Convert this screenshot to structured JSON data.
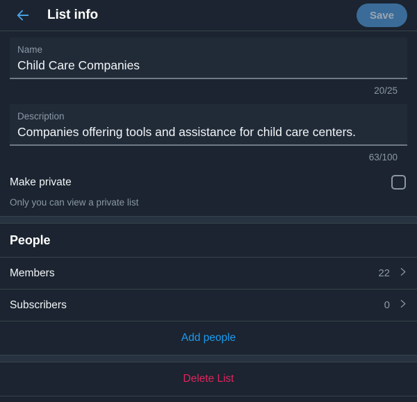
{
  "header": {
    "back_icon": "arrow-left-icon",
    "title": "List info",
    "save_label": "Save"
  },
  "form": {
    "name": {
      "label": "Name",
      "value": "Child Care Companies",
      "placeholder": "Name",
      "counter": "20/25"
    },
    "description": {
      "label": "Description",
      "value": "Companies offering tools and assistance for child care centers.",
      "placeholder": "Description",
      "counter": "63/100"
    },
    "private": {
      "label": "Make private",
      "hint": "Only you can view a private list",
      "checked": false
    }
  },
  "people": {
    "title": "People",
    "rows": [
      {
        "label": "Members",
        "count": "22",
        "chevron": "chevron-right-icon"
      },
      {
        "label": "Subscribers",
        "count": "0",
        "chevron": "chevron-right-icon"
      }
    ],
    "add_people_label": "Add people"
  },
  "danger": {
    "delete_label": "Delete List"
  },
  "colors": {
    "page_bg": "#1b2430",
    "field_bg": "#212b38",
    "band": "#273340",
    "divider": "#38444d",
    "accent": "#1d9bf0",
    "save_bg": "#3b6c99",
    "save_text": "#9aa6b2",
    "muted_text": "#8b98a5",
    "primary_text": "#f2f5f7",
    "danger": "#e0245e"
  }
}
